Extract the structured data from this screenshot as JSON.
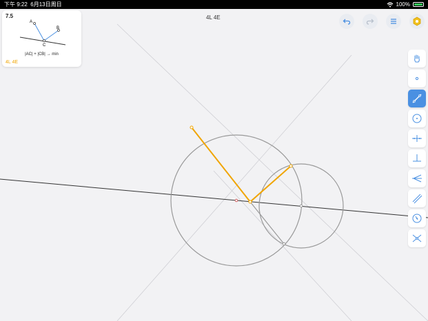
{
  "status_bar": {
    "time": "下午 9:22",
    "date": "6月13日周日",
    "battery_percent": "100%"
  },
  "level_card": {
    "number": "7.5",
    "point_a": "A",
    "point_b": "B",
    "point_c": "C",
    "formula": "|AC| + |CB| → min",
    "goals": "4L  4E"
  },
  "top_goals": "4L  4E",
  "toolbar": {
    "tools": [
      {
        "name": "move",
        "icon": "hand-icon",
        "active": false
      },
      {
        "name": "point",
        "icon": "point-icon",
        "active": false
      },
      {
        "name": "line",
        "icon": "line-icon",
        "active": true
      },
      {
        "name": "circle",
        "icon": "circle-icon",
        "active": false
      },
      {
        "name": "perpendicular-bisector",
        "icon": "perpendicular-bisector-icon",
        "active": false
      },
      {
        "name": "perpendicular",
        "icon": "perpendicular-icon",
        "active": false
      },
      {
        "name": "angle-bisector",
        "icon": "angle-bisector-icon",
        "active": false
      },
      {
        "name": "parallel",
        "icon": "parallel-icon",
        "active": false
      },
      {
        "name": "compass",
        "icon": "compass-icon",
        "active": false
      },
      {
        "name": "intersect",
        "icon": "intersect-icon",
        "active": false
      }
    ]
  },
  "top_buttons": [
    "undo-icon",
    "redo-icon",
    "menu-icon",
    "hint-icon"
  ],
  "colors": {
    "accent": "#f0a500",
    "toolbar_active": "#4a90e2",
    "canvas": "#f2f2f4"
  }
}
